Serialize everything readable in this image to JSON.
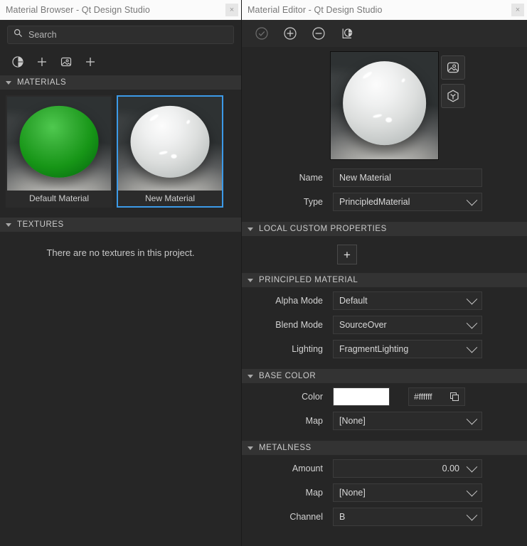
{
  "browser": {
    "title": "Material Browser - Qt Design Studio",
    "close_label": "×",
    "search": {
      "placeholder": "Search",
      "value": ""
    },
    "toolbar": [
      {
        "name": "add-material-icon",
        "tip": "Add Material"
      },
      {
        "name": "plus-icon",
        "tip": "Add"
      },
      {
        "name": "add-texture-icon",
        "tip": "Add Texture"
      },
      {
        "name": "plus-icon",
        "tip": "Add"
      }
    ],
    "sections": {
      "materials": {
        "label": "MATERIALS",
        "expanded": true
      },
      "textures": {
        "label": "TEXTURES",
        "expanded": true,
        "empty_text": "There are no textures in this project."
      }
    },
    "materials": [
      {
        "label": "Default Material",
        "selected": false,
        "color": "#17961 7"
      },
      {
        "label": "New Material",
        "selected": true,
        "color": "#ffffff"
      }
    ]
  },
  "editor": {
    "title": "Material Editor - Qt Design Studio",
    "close_label": "×",
    "toolbar": [
      {
        "name": "apply-to-selected-icon",
        "label": "Apply to selected",
        "disabled": true
      },
      {
        "name": "create-new-material-icon",
        "label": "Create new material",
        "disabled": false
      },
      {
        "name": "delete-material-icon",
        "label": "Delete material",
        "disabled": false
      },
      {
        "name": "open-material-browser-icon",
        "label": "Open material browser",
        "disabled": false
      }
    ],
    "preview_buttons": [
      {
        "name": "preview-environment-icon",
        "label": "Preview environment"
      },
      {
        "name": "preview-model-icon",
        "label": "Preview model"
      }
    ],
    "name_field": {
      "label": "Name",
      "value": "New Material"
    },
    "type_field": {
      "label": "Type",
      "value": "PrincipledMaterial"
    },
    "sections": [
      {
        "label": "LOCAL CUSTOM PROPERTIES",
        "expanded": true
      },
      {
        "label": "PRINCIPLED MATERIAL",
        "expanded": true
      },
      {
        "label": "BASE COLOR",
        "expanded": true
      },
      {
        "label": "METALNESS",
        "expanded": true
      }
    ],
    "add_property_label": "+",
    "principled": {
      "alpha_mode": {
        "label": "Alpha Mode",
        "value": "Default"
      },
      "blend_mode": {
        "label": "Blend Mode",
        "value": "SourceOver"
      },
      "lighting": {
        "label": "Lighting",
        "value": "FragmentLighting"
      }
    },
    "base_color": {
      "color": {
        "label": "Color",
        "swatch": "#ffffff",
        "hex": "#ffffff"
      },
      "map": {
        "label": "Map",
        "value": "[None]"
      }
    },
    "metalness": {
      "amount": {
        "label": "Amount",
        "value": "0.00"
      },
      "map": {
        "label": "Map",
        "value": "[None]"
      },
      "channel": {
        "label": "Channel",
        "value": "B"
      }
    }
  }
}
